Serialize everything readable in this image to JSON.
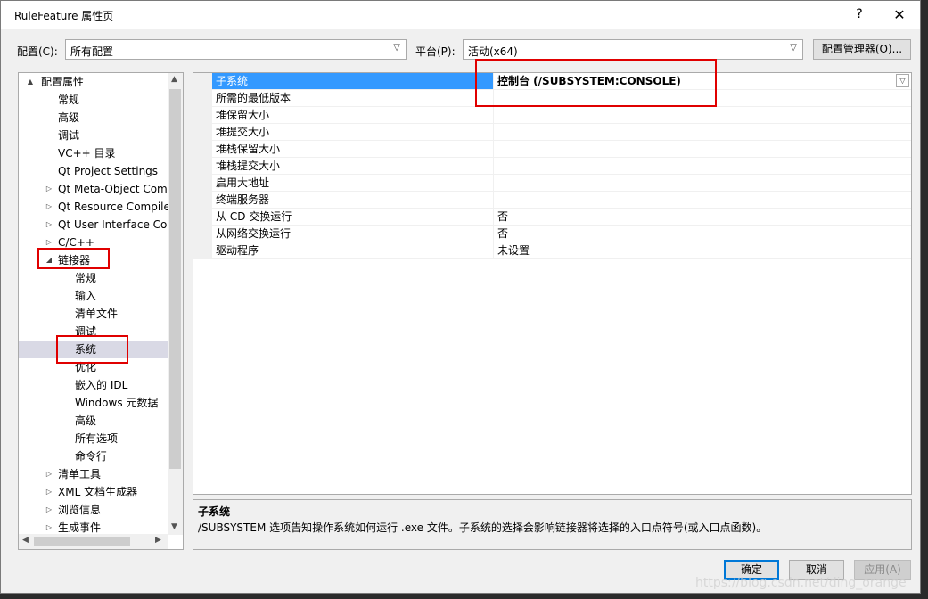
{
  "window": {
    "title": "RuleFeature 属性页",
    "help": "?",
    "close": "✕"
  },
  "config": {
    "label": "配置(C):",
    "value": "所有配置",
    "platform_label": "平台(P):",
    "platform_value": "活动(x64)",
    "manager_button": "配置管理器(O)..."
  },
  "tree": {
    "items": [
      {
        "label": "配置属性",
        "level": 0,
        "arrow": "▲"
      },
      {
        "label": "常规",
        "level": 1,
        "arrow": ""
      },
      {
        "label": "高级",
        "level": 1,
        "arrow": ""
      },
      {
        "label": "调试",
        "level": 1,
        "arrow": ""
      },
      {
        "label": "VC++ 目录",
        "level": 1,
        "arrow": ""
      },
      {
        "label": "Qt Project Settings",
        "level": 1,
        "arrow": ""
      },
      {
        "label": "Qt Meta-Object Compiler",
        "level": 1,
        "arrow": "▷"
      },
      {
        "label": "Qt Resource Compiler",
        "level": 1,
        "arrow": "▷"
      },
      {
        "label": "Qt User Interface Compiler",
        "level": 1,
        "arrow": "▷"
      },
      {
        "label": "C/C++",
        "level": 1,
        "arrow": "▷"
      },
      {
        "label": "链接器",
        "level": 1,
        "arrow": "◢"
      },
      {
        "label": "常规",
        "level": 2,
        "arrow": ""
      },
      {
        "label": "输入",
        "level": 2,
        "arrow": ""
      },
      {
        "label": "清单文件",
        "level": 2,
        "arrow": ""
      },
      {
        "label": "调试",
        "level": 2,
        "arrow": ""
      },
      {
        "label": "系统",
        "level": 2,
        "arrow": "",
        "selected": true
      },
      {
        "label": "优化",
        "level": 2,
        "arrow": ""
      },
      {
        "label": "嵌入的 IDL",
        "level": 2,
        "arrow": ""
      },
      {
        "label": "Windows 元数据",
        "level": 2,
        "arrow": ""
      },
      {
        "label": "高级",
        "level": 2,
        "arrow": ""
      },
      {
        "label": "所有选项",
        "level": 2,
        "arrow": ""
      },
      {
        "label": "命令行",
        "level": 2,
        "arrow": ""
      },
      {
        "label": "清单工具",
        "level": 1,
        "arrow": "▷"
      },
      {
        "label": "XML 文档生成器",
        "level": 1,
        "arrow": "▷"
      },
      {
        "label": "浏览信息",
        "level": 1,
        "arrow": "▷"
      },
      {
        "label": "生成事件",
        "level": 1,
        "arrow": "▷"
      }
    ]
  },
  "grid": {
    "rows": [
      {
        "name": "子系统",
        "value": "控制台 (/SUBSYSTEM:CONSOLE)",
        "selected": true
      },
      {
        "name": "所需的最低版本",
        "value": ""
      },
      {
        "name": "堆保留大小",
        "value": ""
      },
      {
        "name": "堆提交大小",
        "value": ""
      },
      {
        "name": "堆栈保留大小",
        "value": ""
      },
      {
        "name": "堆栈提交大小",
        "value": ""
      },
      {
        "name": "启用大地址",
        "value": ""
      },
      {
        "name": "终端服务器",
        "value": ""
      },
      {
        "name": "从 CD 交换运行",
        "value": "否"
      },
      {
        "name": "从网络交换运行",
        "value": "否"
      },
      {
        "name": "驱动程序",
        "value": "未设置"
      }
    ]
  },
  "description": {
    "title": "子系统",
    "text": "/SUBSYSTEM 选项告知操作系统如何运行 .exe 文件。子系统的选择会影响链接器将选择的入口点符号(或入口点函数)。"
  },
  "buttons": {
    "ok": "确定",
    "cancel": "取消",
    "apply": "应用(A)"
  },
  "watermark": "https://blog.csdn.net/ding_orange",
  "colors": {
    "selection": "#3399ff",
    "highlight": "#e00000"
  }
}
